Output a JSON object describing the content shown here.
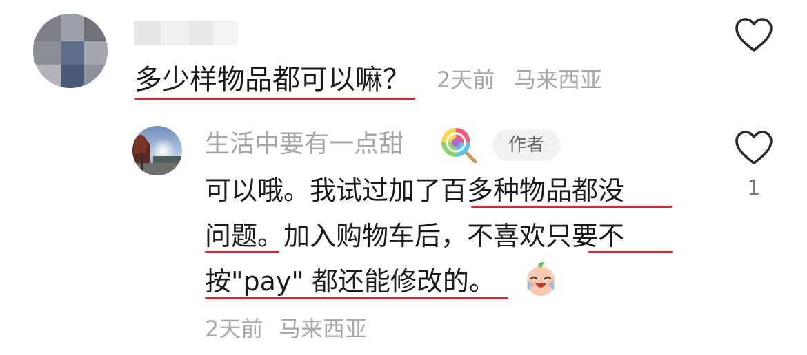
{
  "comment": {
    "text": "多少样物品都可以嘛？",
    "time": "2天前",
    "location": "马来西亚"
  },
  "reply": {
    "author_name": "生活中要有一点甜",
    "author_badge": "作者",
    "lines": [
      "可以哦。我试过加了百多种物品都没",
      "问题。加入购物车后，不喜欢只要不",
      "按\"pay\" 都还能修改的。"
    ],
    "time": "2天前",
    "location": "马来西亚",
    "like_count": "1"
  },
  "icons": {
    "comment_like": "heart-outline-icon",
    "reply_like": "heart-outline-icon",
    "name_emoji": "lollipop-icon",
    "reply_emoji": "crying-laughing-face-icon"
  },
  "colors": {
    "underline": "#d9262f",
    "meta_text": "#a8a8a8",
    "body_text": "#1a1a1a"
  }
}
